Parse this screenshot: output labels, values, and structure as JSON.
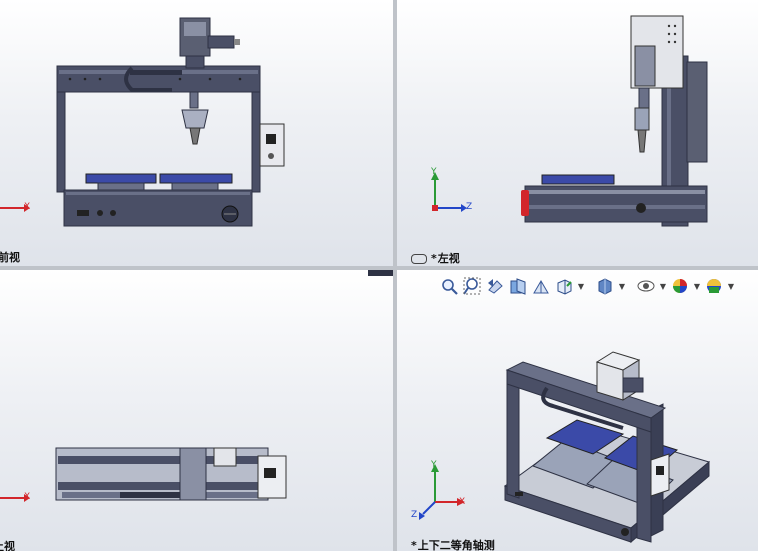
{
  "viewports": {
    "front": {
      "star": "",
      "label": "前视"
    },
    "left": {
      "star": "*",
      "label": "左视"
    },
    "top": {
      "star": "",
      "label": "上视"
    },
    "iso": {
      "star": "*",
      "label": "上下二等角轴测"
    }
  },
  "triad": {
    "x": "X",
    "y": "Y",
    "z": "Z"
  },
  "toolbar": {
    "icons": [
      "zoom-to-fit-icon",
      "zoom-to-area-icon",
      "previous-view-icon",
      "section-view-icon",
      "dynamic-annotation-icon",
      "view-orientation-icon",
      "display-style-icon",
      "hide-show-items-icon",
      "edit-appearance-icon",
      "apply-scene-icon"
    ]
  },
  "colors": {
    "frame": "#4a4f66",
    "frame_dark": "#2e3244",
    "steel": "#9aa3b8",
    "fixture": "#3b4aa8",
    "axis_x": "#d2262b",
    "axis_y": "#2a9a36",
    "axis_z": "#2346c8",
    "viewport_divider": "#bfc3c9"
  }
}
